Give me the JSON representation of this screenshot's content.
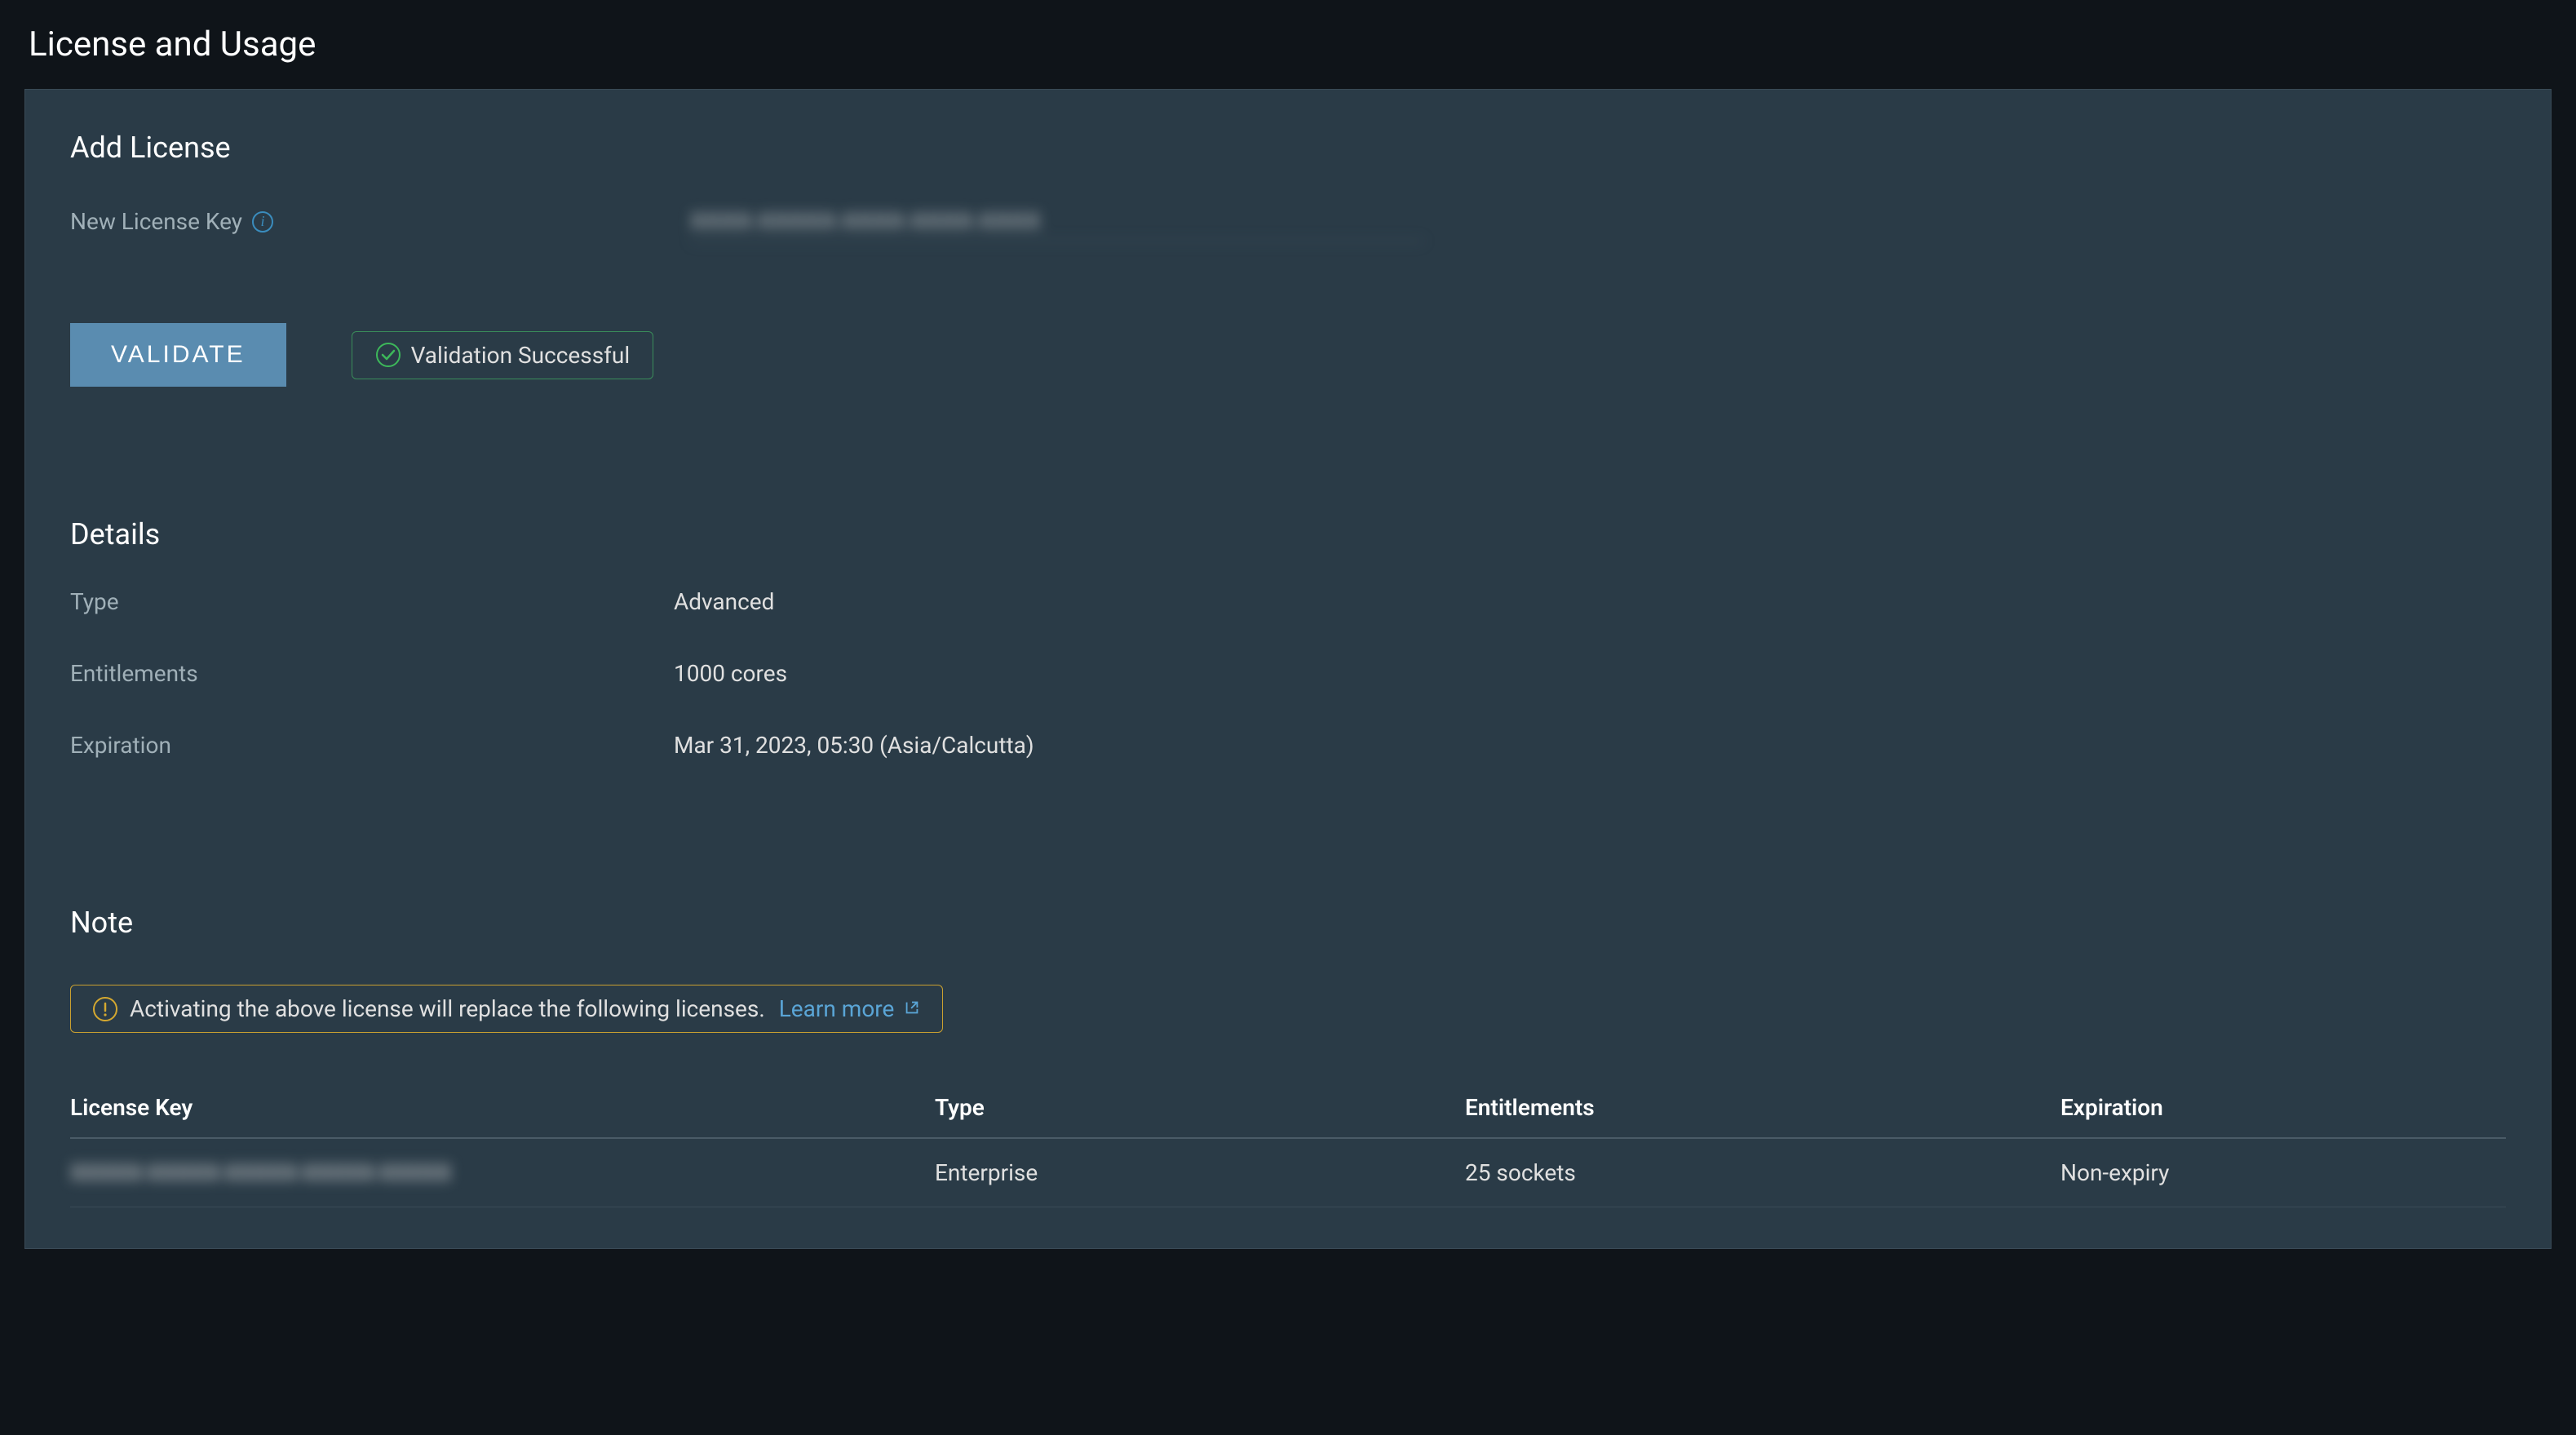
{
  "page_title": "License and Usage",
  "add_license": {
    "title": "Add License",
    "label": "New License Key",
    "input_value": "XXXX-XXXXX-XXXX-XXXX-XXXX",
    "validate_button": "VALIDATE",
    "validation_status": "Validation Successful"
  },
  "details": {
    "title": "Details",
    "type_label": "Type",
    "type_value": "Advanced",
    "entitlements_label": "Entitlements",
    "entitlements_value": "1000 cores",
    "expiration_label": "Expiration",
    "expiration_value": "Mar 31, 2023, 05:30 (Asia/Calcutta)"
  },
  "note": {
    "title": "Note",
    "message": "Activating the above license will replace the following licenses.",
    "learn_more": "Learn more"
  },
  "license_table": {
    "headers": {
      "license_key": "License Key",
      "type": "Type",
      "entitlements": "Entitlements",
      "expiration": "Expiration"
    },
    "rows": [
      {
        "license_key": "XXXXX-XXXXX-XXXXX-XXXXX-XXXXX",
        "type": "Enterprise",
        "entitlements": "25 sockets",
        "expiration": "Non-expiry"
      }
    ]
  }
}
